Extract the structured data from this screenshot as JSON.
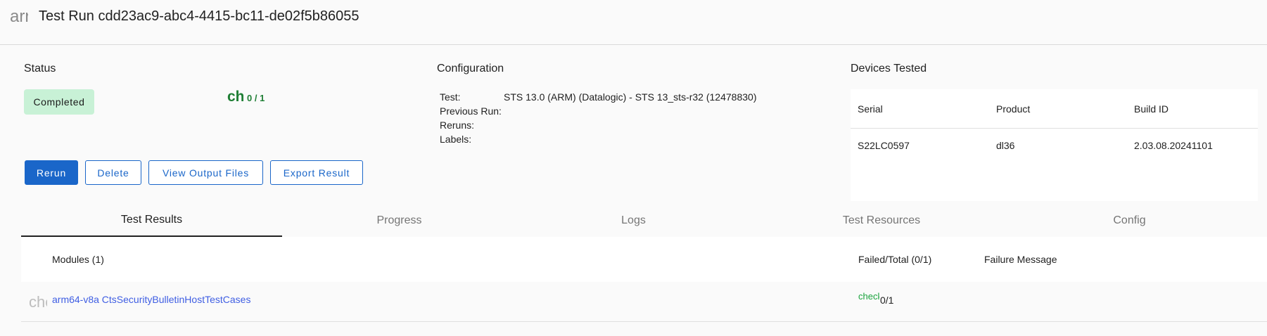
{
  "header": {
    "icon_text": "arrow_back",
    "icon": "arrow-back-icon",
    "title": "Test Run cdd23ac9-abc4-4415-bc11-de02f5b86055"
  },
  "status": {
    "title": "Status",
    "chip": "Completed",
    "pass_icon_text": "check",
    "pass_icon": "check-icon",
    "pass_count": "0 / 1",
    "buttons": {
      "rerun": "Rerun",
      "delete": "Delete",
      "view_output": "View Output Files",
      "export": "Export Result"
    }
  },
  "configuration": {
    "title": "Configuration",
    "test_label": "Test:",
    "test_value": "STS 13.0 (ARM) (Datalogic) - STS 13_sts-r32 (12478830)",
    "previous_run_label": "Previous Run:",
    "reruns_label": "Reruns:",
    "labels_label": "Labels:"
  },
  "devices": {
    "title": "Devices Tested",
    "columns": [
      "Serial",
      "Product",
      "Build ID"
    ],
    "rows": [
      [
        "S22LC0597",
        "dl36",
        "2.03.08.20241101"
      ]
    ]
  },
  "tabs": [
    "Test Results",
    "Progress",
    "Logs",
    "Test Resources",
    "Config"
  ],
  "results": {
    "modules_header": "Modules (1)",
    "failed_total_header": "Failed/Total (0/1)",
    "failure_message_header": "Failure Message",
    "rows": [
      {
        "icon_text": "chevron_right",
        "icon": "chevron-right-icon",
        "module": "arm64-v8a CtsSecurityBulletinHostTestCases",
        "status_icon_text": "check",
        "status_icon": "check-icon",
        "failed_total": "0/1"
      }
    ]
  },
  "colors": {
    "primary": "#1a66c9",
    "success_chip": "#c8f1d6",
    "success_text": "#1e7e34",
    "link": "#3f5ee3"
  }
}
